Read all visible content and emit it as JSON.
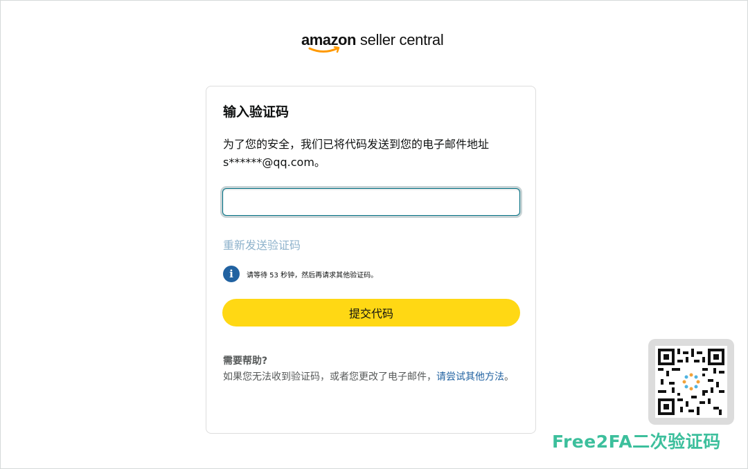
{
  "header": {
    "logo_wordmark": "amazon",
    "logo_product": "seller central"
  },
  "card": {
    "title": "输入验证码",
    "description_line1": "为了您的安全，我们已将代码发送到您的电子邮件地址",
    "description_line2": "s******@qq.com。",
    "code_input": {
      "value": "",
      "placeholder": ""
    },
    "resend_link": "重新发送验证码",
    "info_icon_glyph": "i",
    "info_message": "请等待 53 秒钟，然后再请求其他验证码。",
    "submit_label": "提交代码",
    "help": {
      "title": "需要帮助?",
      "text": "如果您无法收到验证码，或者您更改了电子邮件，",
      "link": "请尝试其他方法",
      "suffix": "。"
    }
  },
  "watermark": {
    "qr_icon": "qr-code-icon",
    "text": "Free2FA二次验证码"
  },
  "colors": {
    "primary_button": "#ffd814",
    "link": "#2162a1",
    "disabled_link": "#8fb3cc",
    "info_icon": "#2162a1",
    "watermark": "#3cbf9c"
  }
}
